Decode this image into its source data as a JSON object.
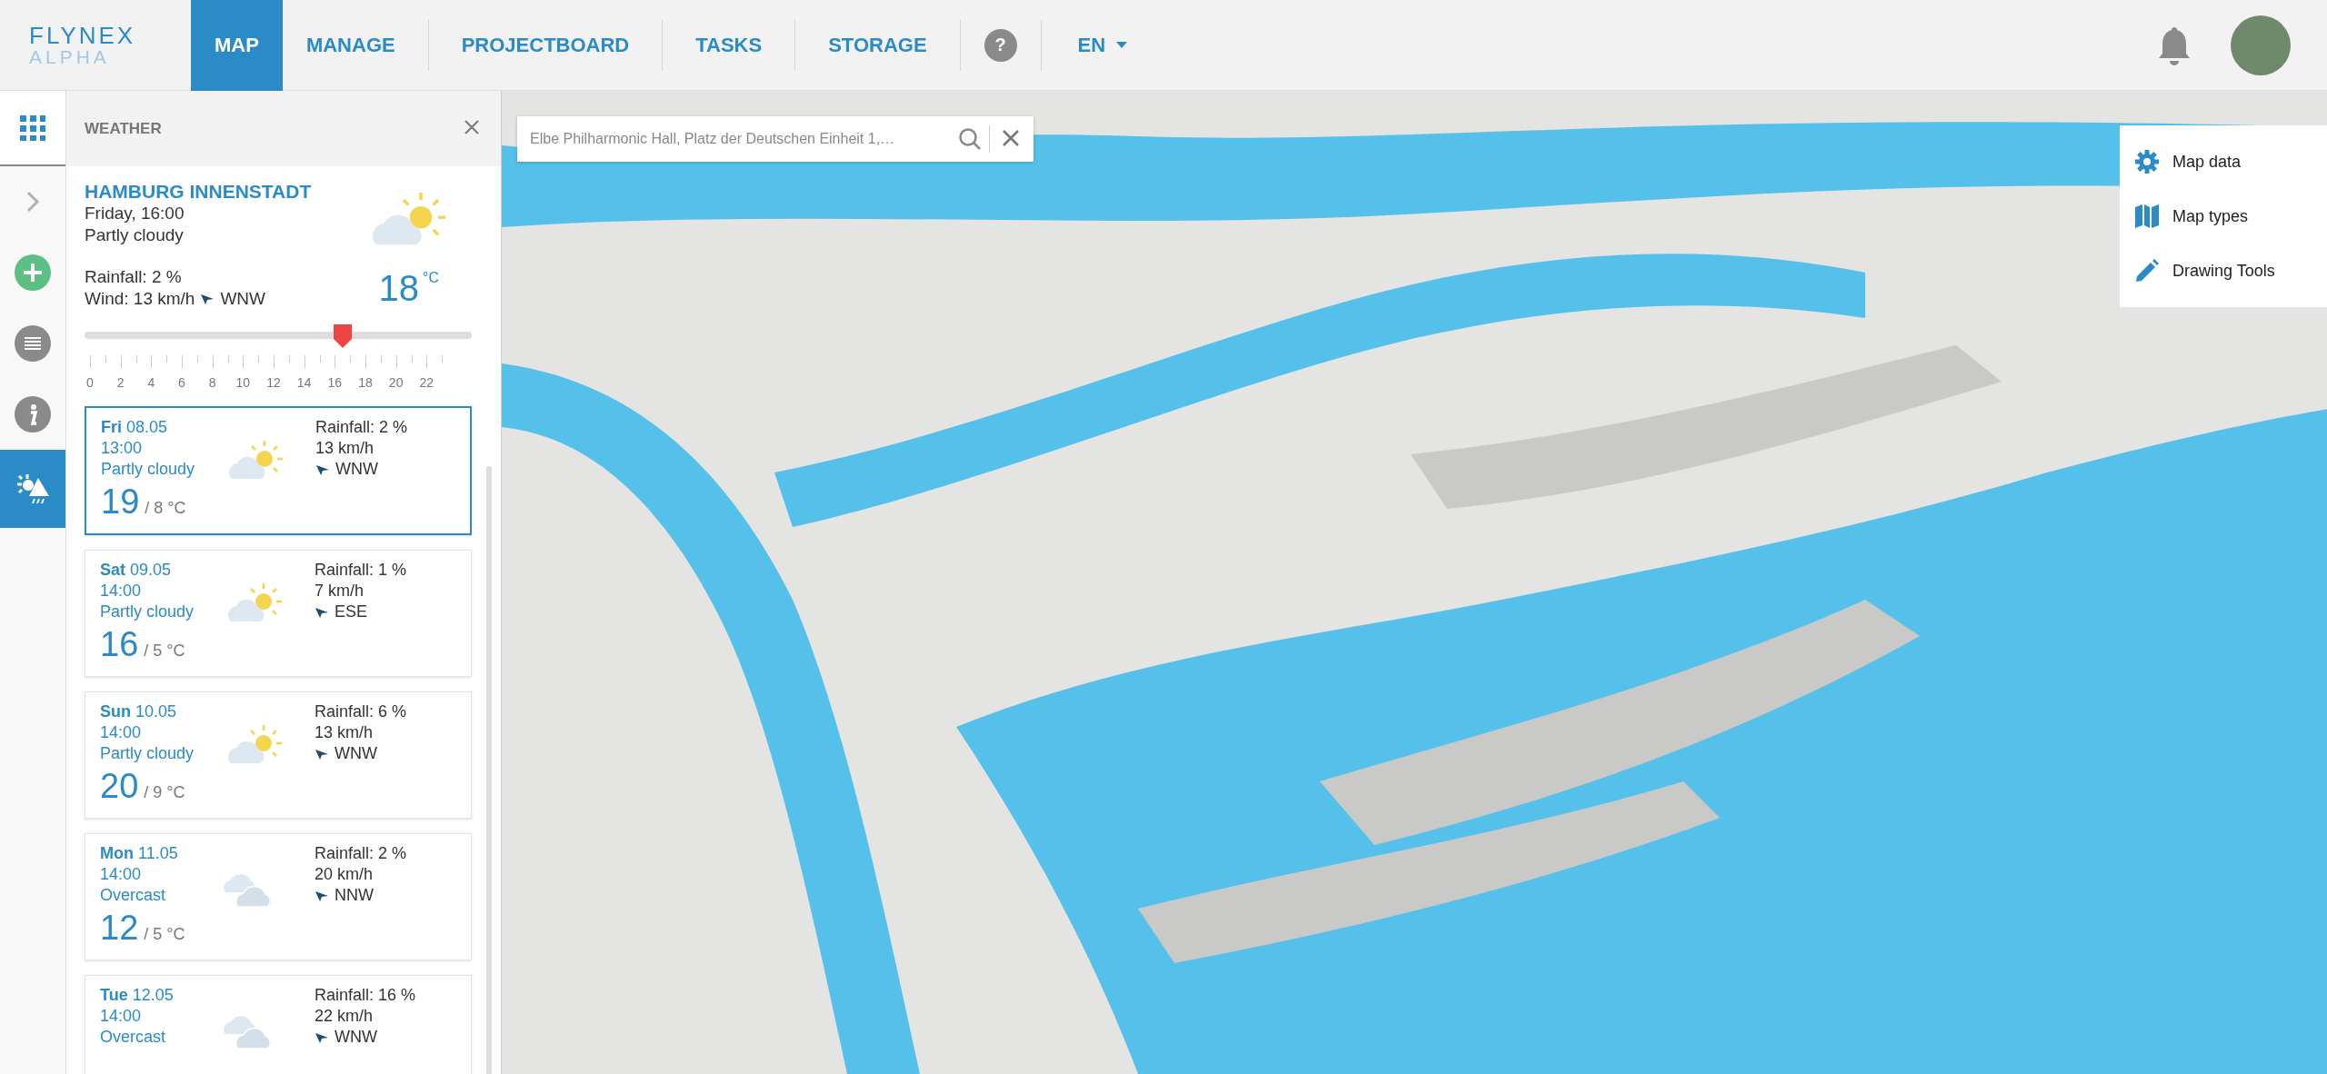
{
  "header": {
    "logo": {
      "name": "FLYNEX",
      "tagline": "ALPHA"
    },
    "nav": [
      {
        "label": "MAP",
        "selected": true
      },
      {
        "label": "MANAGE",
        "selected": false
      },
      {
        "label": "PROJECTBOARD",
        "selected": false
      },
      {
        "label": "TASKS",
        "selected": false
      },
      {
        "label": "STORAGE",
        "selected": false
      }
    ],
    "help": "?",
    "language": "EN"
  },
  "rail": [
    {
      "kind": "apps",
      "selected": false
    },
    {
      "kind": "expand",
      "selected": false
    },
    {
      "kind": "add",
      "selected": false
    },
    {
      "kind": "list",
      "selected": false
    },
    {
      "kind": "info",
      "selected": false
    },
    {
      "kind": "weather",
      "selected": true
    }
  ],
  "weather_panel": {
    "title": "WEATHER",
    "current": {
      "location": "HAMBURG INNENSTADT",
      "datetime": "Friday, 16:00",
      "condition": "Partly cloudy",
      "kind": "partly_cloudy",
      "rainfall": "Rainfall: 2 %",
      "wind": "Wind: 13 km/h",
      "wind_direction": "WNW",
      "temperature": "18",
      "unit": "°C"
    },
    "timeline": {
      "level": 0.667,
      "labels": [
        "0",
        "2",
        "4",
        "6",
        "8",
        "10",
        "12",
        "14",
        "16",
        "18",
        "20",
        "22"
      ]
    },
    "forecast": [
      {
        "day": "Fri",
        "date": "08.05",
        "time": "13:00",
        "condition": "Partly cloudy",
        "kind": "partly_cloudy",
        "high": "19",
        "low": "/ 8 °C",
        "rainfall": "Rainfall: 2 %",
        "wind_speed": "13 km/h",
        "wind_direction": "WNW",
        "selected": true
      },
      {
        "day": "Sat",
        "date": "09.05",
        "time": "14:00",
        "condition": "Partly cloudy",
        "kind": "partly_cloudy",
        "high": "16",
        "low": "/ 5 °C",
        "rainfall": "Rainfall: 1 %",
        "wind_speed": "7 km/h",
        "wind_direction": "ESE",
        "selected": false
      },
      {
        "day": "Sun",
        "date": "10.05",
        "time": "14:00",
        "condition": "Partly cloudy",
        "kind": "partly_cloudy",
        "high": "20",
        "low": "/ 9 °C",
        "rainfall": "Rainfall: 6 %",
        "wind_speed": "13 km/h",
        "wind_direction": "WNW",
        "selected": false
      },
      {
        "day": "Mon",
        "date": "11.05",
        "time": "14:00",
        "condition": "Overcast",
        "kind": "overcast",
        "high": "12",
        "low": "/ 5 °C",
        "rainfall": "Rainfall: 2 %",
        "wind_speed": "20 km/h",
        "wind_direction": "NNW",
        "selected": false
      },
      {
        "day": "Tue",
        "date": "12.05",
        "time": "14:00",
        "condition": "Overcast",
        "kind": "overcast",
        "rainfall": "Rainfall: 16 %",
        "wind_speed": "22 km/h",
        "wind_direction": "WNW",
        "selected": false
      }
    ]
  },
  "search": {
    "value": "Elbe Philharmonic Hall, Platz der Deutschen Einheit 1,…"
  },
  "map_menu": [
    {
      "label": "Map data",
      "kind": "settings"
    },
    {
      "label": "Map types",
      "kind": "map"
    },
    {
      "label": "Drawing Tools",
      "kind": "pencil"
    }
  ]
}
